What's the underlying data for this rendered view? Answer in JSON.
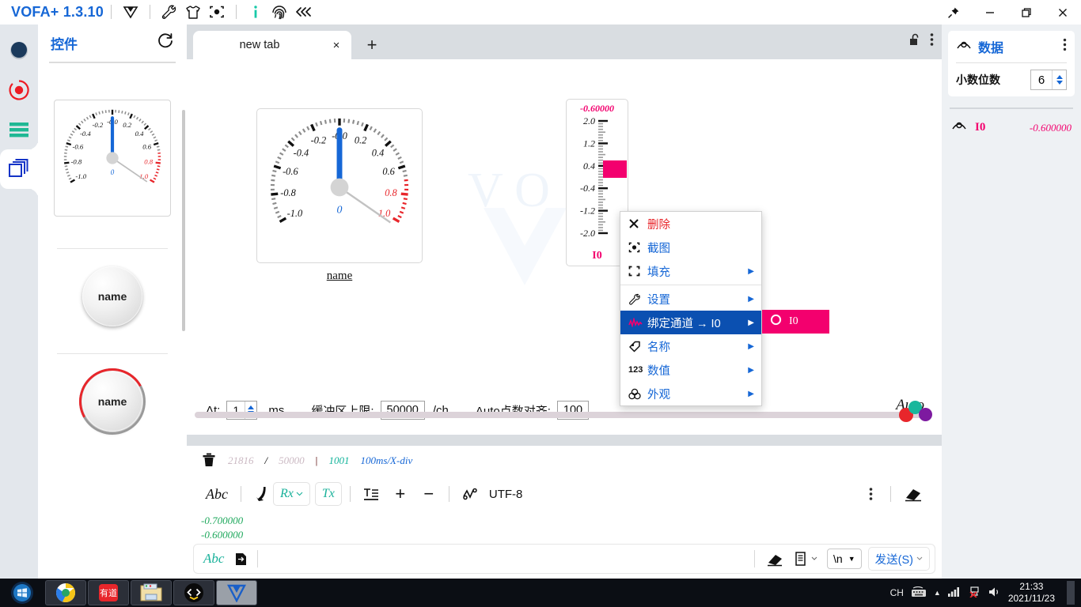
{
  "titlebar": {
    "app_title": "VOFA+ 1.3.10",
    "icons": [
      "vofa-logo-icon",
      "wrench-icon",
      "shirt-icon",
      "target-icon",
      "info-icon",
      "fingerprint-icon",
      "collapse-left-icon"
    ],
    "window_controls": [
      "pin-icon",
      "minimize-icon",
      "maximize-icon",
      "close-icon"
    ]
  },
  "rail": {
    "items": [
      {
        "name": "connection-status-icon"
      },
      {
        "name": "record-icon"
      },
      {
        "name": "menu-lines-icon"
      },
      {
        "name": "widgets-icon",
        "active": true
      }
    ]
  },
  "palette": {
    "title": "控件",
    "refresh_icon": "refresh-icon",
    "items": [
      {
        "type": "gauge-widget",
        "name": "gauge"
      },
      {
        "type": "button-widget",
        "name": "button",
        "label": "name"
      },
      {
        "type": "knob-widget",
        "name": "knob",
        "label": "name"
      }
    ]
  },
  "tabs": {
    "items": [
      {
        "label": "new tab",
        "active": true
      }
    ],
    "close_label": "×",
    "add_label": "+",
    "lock_icon": "unlock-icon",
    "more_icon": "kebab-menu-icon"
  },
  "canvas": {
    "watermark": "VOFA",
    "gauge": {
      "label": "name",
      "center_value": "0",
      "tick_labels": [
        "-1.0",
        "-0.8",
        "-0.6",
        "-0.4",
        "-0.2",
        "-0.0",
        "0.2",
        "0.4",
        "0.6",
        "0.8",
        "1.0"
      ],
      "min": -1.0,
      "max": 1.0,
      "needle_value": 0,
      "alarm_from": 0.7,
      "accent": "#1667d6",
      "alarm_color": "#e8262b"
    },
    "bar": {
      "value_text": "-0.60000",
      "value": -0.6,
      "channel": "I0",
      "tick_labels": [
        "2.0",
        "1.2",
        "0.4",
        "-0.4",
        "-1.2",
        "-2.0"
      ],
      "min": -2.0,
      "max": 2.0,
      "color": "#f3006e"
    }
  },
  "plotbar": {
    "dt_label": "Δt:",
    "dt_value": "1",
    "dt_unit": "ms",
    "buffer_label": "缓冲区上限:",
    "buffer_value": "50000",
    "buffer_unit": "/ch",
    "align_label": "Auto点数对齐:",
    "align_value": "100",
    "auto_label": "Auto"
  },
  "statusbar": {
    "trash_icon": "trash-icon",
    "current_points": "21816",
    "slash": "/",
    "max_points": "50000",
    "divider": "|",
    "sample_count": "1001",
    "timebase": "100ms/X-div"
  },
  "terminal": {
    "toolbar": {
      "font_btn": "Abc",
      "phone_icon": "serial-port-icon",
      "rx_label": "Rx",
      "tx_label": "Tx",
      "format_icon": "text-format-icon",
      "plus_label": "+",
      "minus_label": "−",
      "waveform_icon": "waveform-icon",
      "encoding": "UTF-8",
      "more_icon": "kebab-menu-icon",
      "clear_icon": "eraser-icon"
    },
    "log_lines": [
      "-0.700000",
      "-0.600000"
    ],
    "send": {
      "abc_label": "Abc",
      "wrap_icon": "wrap-arrow-icon",
      "input_value": "",
      "input_placeholder": "",
      "eraser_icon": "eraser-icon",
      "file_icon": "file-icon",
      "newline_value": "\\n",
      "send_label": "发送(S)"
    }
  },
  "rightpanel": {
    "title": "数据",
    "eye_icon": "visibility-icon",
    "more_icon": "kebab-menu-icon",
    "decimals_label": "小数位数",
    "decimals_value": "6",
    "channels": [
      {
        "eye_icon": "visibility-icon",
        "name": "I0",
        "value": "-0.600000"
      }
    ]
  },
  "contextmenu": {
    "items": [
      {
        "label": "删除",
        "icon": "close-x-icon",
        "danger": true,
        "arrow": false
      },
      {
        "label": "截图",
        "icon": "screenshot-icon",
        "arrow": false
      },
      {
        "label": "填充",
        "icon": "fill-expand-icon",
        "arrow": true
      },
      {
        "label": "设置",
        "icon": "wrench-icon",
        "arrow": true,
        "rule_before": true
      },
      {
        "label": "绑定通道 → I0",
        "icon": "waveform-icon",
        "arrow": true,
        "selected": true
      },
      {
        "label": "名称",
        "icon": "tag-icon",
        "arrow": true
      },
      {
        "label": "数值",
        "icon": "digits-icon",
        "arrow": true
      },
      {
        "label": "外观",
        "icon": "appearance-icon",
        "arrow": true
      }
    ],
    "submenu": {
      "items": [
        {
          "label": "I0",
          "icon": "circle-icon"
        }
      ],
      "bg": "#f3006e"
    }
  },
  "taskbar": {
    "start_icon": "windows-start-icon",
    "apps": [
      "chrome-icon",
      "youdao-icon",
      "file-explorer-icon",
      "vscode-alt-icon",
      "vofa-icon"
    ],
    "tray": {
      "ime": "CH",
      "keyboard_icon": "keyboard-icon",
      "chevron_icon": "show-hidden-icon",
      "network_icon": "network-icon",
      "network_alert_icon": "network-error-icon",
      "volume_icon": "volume-icon",
      "time": "21:33",
      "date": "2021/11/23"
    }
  }
}
